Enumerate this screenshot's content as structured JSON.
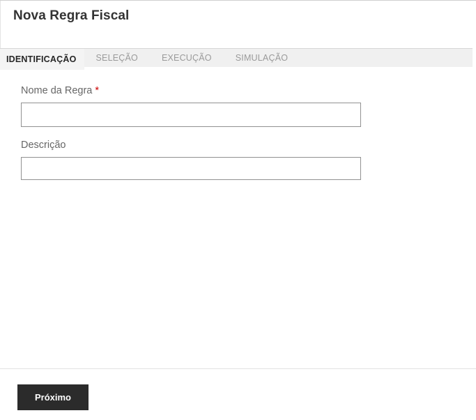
{
  "page": {
    "title": "Nova Regra Fiscal"
  },
  "tabs": [
    {
      "label": "IDENTIFICAÇÃO",
      "active": true
    },
    {
      "label": "SELEÇÃO",
      "active": false
    },
    {
      "label": "EXECUÇÃO",
      "active": false
    },
    {
      "label": "SIMULAÇÃO",
      "active": false
    }
  ],
  "form": {
    "fields": [
      {
        "label": "Nome da Regra",
        "required": true,
        "required_marker": "*",
        "value": ""
      },
      {
        "label": "Descrição",
        "required": false,
        "value": ""
      }
    ]
  },
  "actions": {
    "next_label": "Próximo"
  },
  "colors": {
    "required_marker": "#cc0000",
    "button_bg": "#2b2b2b",
    "button_text": "#ffffff",
    "tabbar_bg": "#f0f0f0",
    "active_tab_text": "#262626",
    "inactive_tab_text": "#9a9a9a",
    "input_border": "#919191",
    "label_text": "#666666"
  }
}
